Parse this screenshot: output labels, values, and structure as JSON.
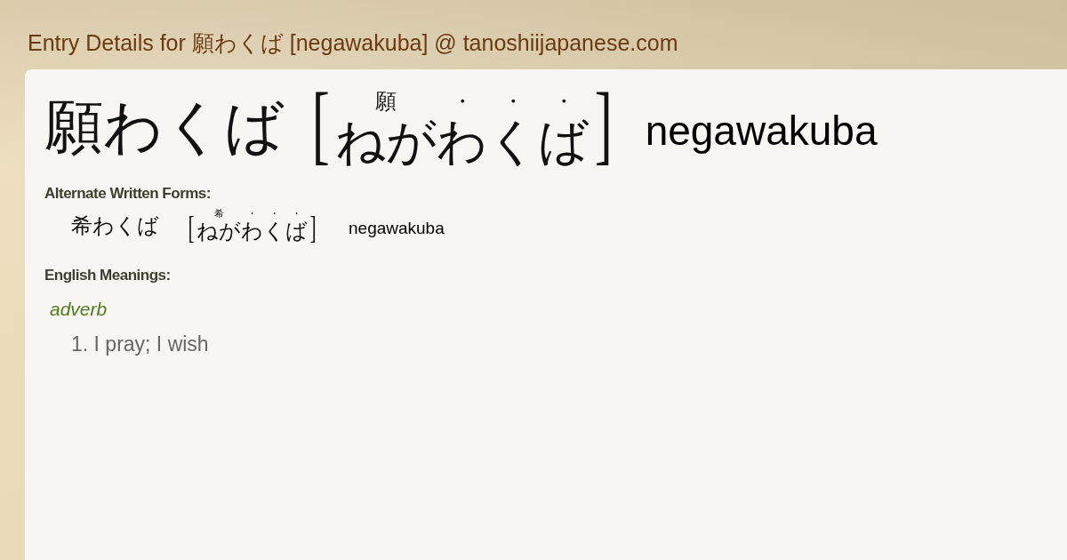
{
  "page_title": "Entry Details for 願わくば [negawakuba] @ tanoshiijapanese.com",
  "entry": {
    "headword": "願わくば",
    "brackets": [
      "[",
      "]"
    ],
    "reading": [
      {
        "ruby": "願",
        "kana": "ねが"
      },
      {
        "ruby": "・",
        "kana": "わ"
      },
      {
        "ruby": "・",
        "kana": "く"
      },
      {
        "ruby": "・",
        "kana": "ば"
      }
    ],
    "romaji": "negawakuba"
  },
  "alternate_forms": {
    "heading": "Alternate Written Forms:",
    "forms": [
      {
        "written": "希わくば",
        "brackets": [
          "[",
          "]"
        ],
        "reading": [
          {
            "ruby": "希",
            "kana": "ねが"
          },
          {
            "ruby": "・",
            "kana": "わ"
          },
          {
            "ruby": "・",
            "kana": "く"
          },
          {
            "ruby": "・",
            "kana": "ば"
          }
        ],
        "romaji": "negawakuba"
      }
    ]
  },
  "meanings": {
    "heading": "English Meanings:",
    "groups": [
      {
        "part_of_speech": "adverb",
        "senses": [
          "1. I pray; I wish"
        ]
      }
    ]
  }
}
